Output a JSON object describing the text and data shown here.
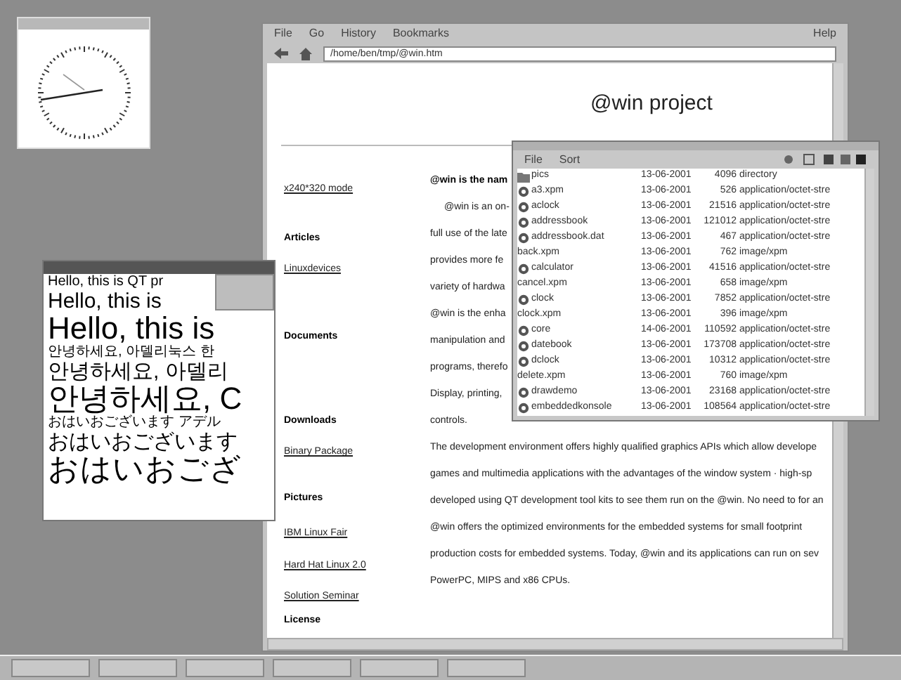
{
  "browser": {
    "menu": [
      "File",
      "Go",
      "History",
      "Bookmarks"
    ],
    "help_menu": "Help",
    "url": "/home/ben/tmp/@win.htm",
    "page_title": "@win project",
    "sidebar": [
      {
        "kind": "link",
        "text": "x240*320 mode"
      },
      {
        "kind": "heading",
        "text": "Articles"
      },
      {
        "kind": "link",
        "text": "Linuxdevices"
      },
      {
        "kind": "heading",
        "text": "Documents"
      },
      {
        "kind": "heading",
        "text": "Downloads"
      },
      {
        "kind": "link",
        "text": "Binary Package"
      },
      {
        "kind": "heading",
        "text": "Pictures"
      },
      {
        "kind": "link",
        "text": "IBM Linux Fair"
      },
      {
        "kind": "link",
        "text": "Hard Hat Linux 2.0"
      },
      {
        "kind": "link",
        "text": "Solution Seminar"
      },
      {
        "kind": "heading",
        "text": "License"
      }
    ],
    "body_lines": [
      {
        "kind": "bold",
        "text": "@win is the nam"
      },
      {
        "kind": "indent",
        "text": "@win is an on-"
      },
      {
        "kind": "plain",
        "text": "full use of the late"
      },
      {
        "kind": "plain",
        "text": "provides more fe"
      },
      {
        "kind": "plain",
        "text": "variety of hardwa"
      },
      {
        "kind": "plain",
        "text": "@win is the enha"
      },
      {
        "kind": "plain",
        "text": "manipulation and"
      },
      {
        "kind": "plain",
        "text": "programs, therefo"
      },
      {
        "kind": "plain",
        "text": "Display, printing,"
      },
      {
        "kind": "plain",
        "text": "controls."
      },
      {
        "kind": "plain",
        "text": "The development environment offers highly qualified graphics APIs which allow develope"
      },
      {
        "kind": "plain",
        "text": "games and multimedia applications with the advantages of the window system  · high-sp"
      },
      {
        "kind": "plain",
        "text": "developed using QT development tool kits to see them run on the @win. No need to for an"
      },
      {
        "kind": "plain",
        "text": "@win offers the optimized environments for the embedded systems for small footprint"
      },
      {
        "kind": "plain",
        "text": "production costs for embedded systems. Today, @win and its applications can run on sev"
      },
      {
        "kind": "plain",
        "text": "PowerPC, MIPS and x86 CPUs."
      }
    ]
  },
  "file_manager": {
    "menu": [
      "File",
      "Sort"
    ],
    "files": [
      {
        "kind": "folder",
        "name": "pics",
        "date": "13-06-2001",
        "size": "4096",
        "type": "directory"
      },
      {
        "kind": "app",
        "name": "a3.xpm",
        "date": "13-06-2001",
        "size": "526",
        "type": "application/octet-stre"
      },
      {
        "kind": "app",
        "name": "aclock",
        "date": "13-06-2001",
        "size": "21516",
        "type": "application/octet-stre"
      },
      {
        "kind": "app",
        "name": "addressbook",
        "date": "13-06-2001",
        "size": "121012",
        "type": "application/octet-stre"
      },
      {
        "kind": "app",
        "name": "addressbook.dat",
        "date": "13-06-2001",
        "size": "467",
        "type": "application/octet-stre"
      },
      {
        "kind": "image",
        "name": "back.xpm",
        "date": "13-06-2001",
        "size": "762",
        "type": "image/xpm"
      },
      {
        "kind": "app",
        "name": "calculator",
        "date": "13-06-2001",
        "size": "41516",
        "type": "application/octet-stre"
      },
      {
        "kind": "image",
        "name": "cancel.xpm",
        "date": "13-06-2001",
        "size": "658",
        "type": "image/xpm"
      },
      {
        "kind": "app",
        "name": "clock",
        "date": "13-06-2001",
        "size": "7852",
        "type": "application/octet-stre"
      },
      {
        "kind": "image",
        "name": "clock.xpm",
        "date": "13-06-2001",
        "size": "396",
        "type": "image/xpm"
      },
      {
        "kind": "app",
        "name": "core",
        "date": "14-06-2001",
        "size": "110592",
        "type": "application/octet-stre"
      },
      {
        "kind": "app",
        "name": "datebook",
        "date": "13-06-2001",
        "size": "173708",
        "type": "application/octet-stre"
      },
      {
        "kind": "app",
        "name": "dclock",
        "date": "13-06-2001",
        "size": "10312",
        "type": "application/octet-stre"
      },
      {
        "kind": "image",
        "name": "delete.xpm",
        "date": "13-06-2001",
        "size": "760",
        "type": "image/xpm"
      },
      {
        "kind": "app",
        "name": "drawdemo",
        "date": "13-06-2001",
        "size": "23168",
        "type": "application/octet-stre"
      },
      {
        "kind": "app",
        "name": "embeddedkonsole",
        "date": "13-06-2001",
        "size": "108564",
        "type": "application/octet-stre"
      }
    ]
  },
  "hello_window": {
    "lines": [
      {
        "kind": "small",
        "text": "Hello, this is QT pr"
      },
      {
        "kind": "medium",
        "text": "Hello, this is"
      },
      {
        "kind": "large",
        "text": "Hello, this is"
      },
      {
        "kind": "small",
        "text": "안녕하세요, 아델리눅스 한"
      },
      {
        "kind": "medium",
        "text": "안녕하세요, 아델리"
      },
      {
        "kind": "large",
        "text": "안녕하세요, C"
      },
      {
        "kind": "small",
        "text": "おはいおございます アデル"
      },
      {
        "kind": "medium",
        "text": "おはいおございます"
      },
      {
        "kind": "large",
        "text": "おはいおござ"
      }
    ]
  }
}
